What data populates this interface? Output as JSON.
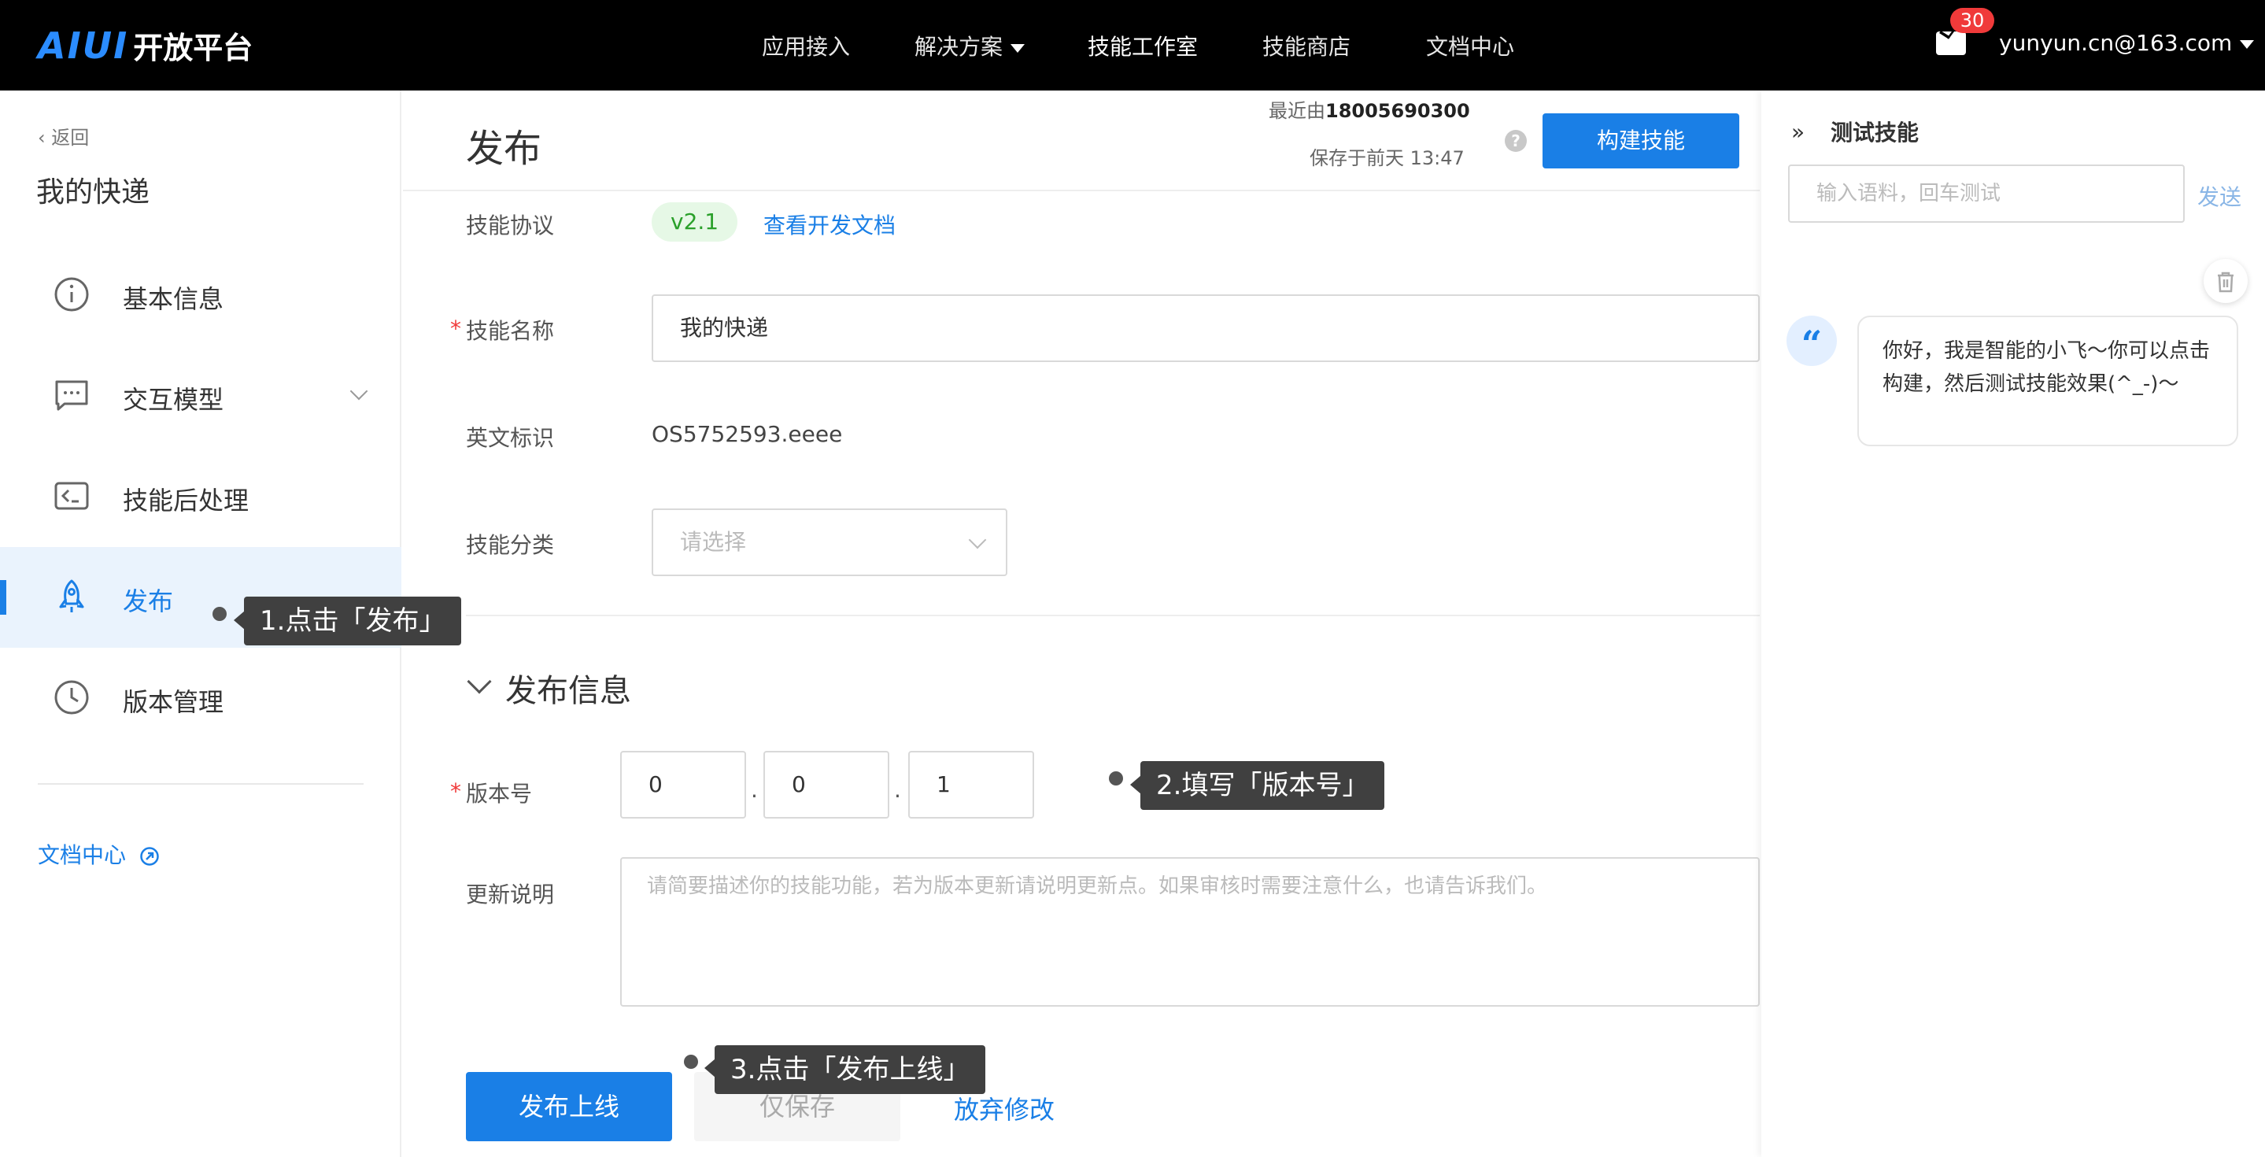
{
  "topbar": {
    "logo_mark": "AIUI",
    "logo_text": "开放平台",
    "nav": [
      {
        "label": "应用接入"
      },
      {
        "label": "解决方案"
      },
      {
        "label": "技能工作室"
      },
      {
        "label": "技能商店"
      },
      {
        "label": "文档中心"
      }
    ],
    "mail_count": "30",
    "user_email": "yunyun.cn@163.com"
  },
  "sidebar": {
    "back_label": "返回",
    "project_title": "我的快递",
    "items": [
      {
        "label": "基本信息",
        "icon": "info-icon"
      },
      {
        "label": "交互模型",
        "icon": "message-icon"
      },
      {
        "label": "技能后处理",
        "icon": "code-icon"
      },
      {
        "label": "发布",
        "icon": "rocket-icon"
      },
      {
        "label": "版本管理",
        "icon": "clock-icon"
      }
    ],
    "doc_link": "文档中心"
  },
  "main": {
    "title": "发布",
    "recent_prefix": "最近由",
    "recent_user": "18005690300",
    "saved_text": "保存于前天 13:47",
    "build_button": "构建技能",
    "protocol_label": "技能协议",
    "protocol_version": "v2.1",
    "protocol_doc_link": "查看开发文档",
    "name_label": "技能名称",
    "name_value": "我的快递",
    "en_label": "英文标识",
    "en_value": "OS5752593.eeee",
    "category_label": "技能分类",
    "category_placeholder": "请选择",
    "section_title": "发布信息",
    "version_label": "版本号",
    "version": [
      "0",
      "0",
      "1"
    ],
    "version_sep": ".",
    "notes_label": "更新说明",
    "notes_placeholder": "请简要描述你的技能功能，若为版本更新请说明更新点。如果审核时需要注意什么，也请告诉我们。",
    "publish_button": "发布上线",
    "save_button": "仅保存",
    "discard_button": "放弃修改"
  },
  "test_panel": {
    "title": "测试技能",
    "input_placeholder": "输入语料，回车测试",
    "send_label": "发送",
    "bot_message": "你好，我是智能的小飞～你可以点击构建，然后测试技能效果(^_-)～"
  },
  "tooltips": {
    "step1": "1.点击「发布」",
    "step2": "2.填写「版本号」",
    "step3": "3.点击「发布上线」"
  },
  "colors": {
    "accent": "#1a7fe6",
    "topbar": "#000000",
    "badge": "#f03a3a",
    "version_tag_bg": "#e6f8e6",
    "version_tag_text": "#2aa02a"
  }
}
